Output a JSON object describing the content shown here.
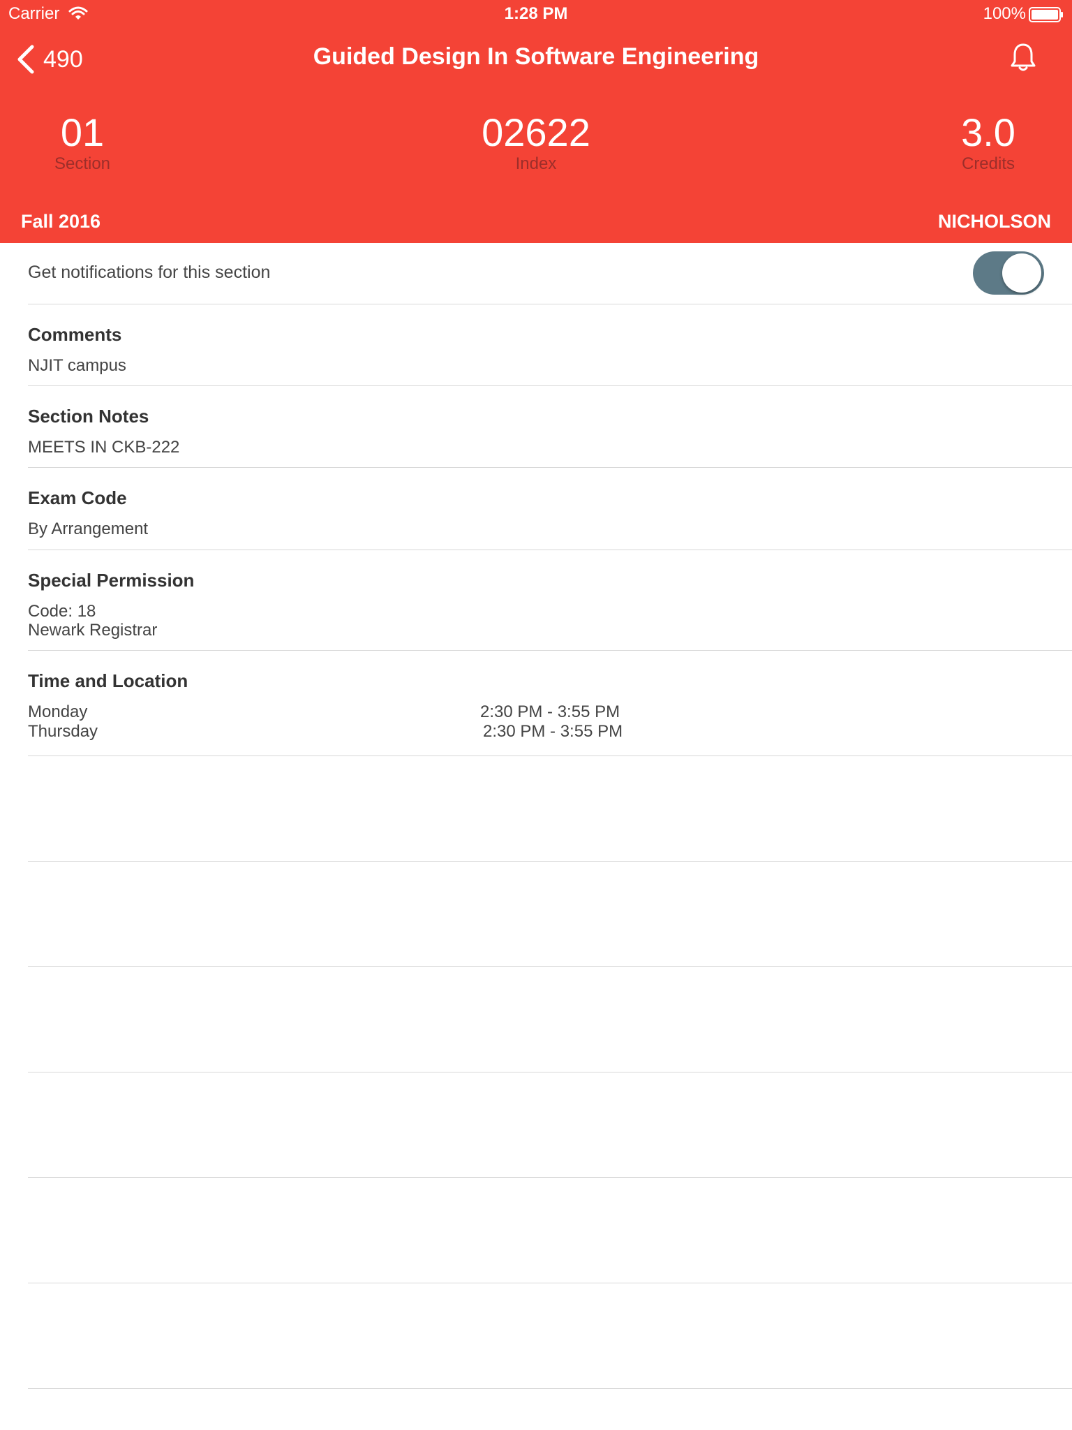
{
  "status_bar": {
    "carrier": "Carrier",
    "time": "1:28 PM",
    "battery": "100%",
    "icons": [
      "wifi-icon",
      "battery-icon"
    ]
  },
  "nav": {
    "back_label": "490",
    "title": "Guided Design In Software Engineering",
    "back_icon": "chevron-left-icon",
    "bell_icon": "bell-icon"
  },
  "stats": {
    "section": {
      "value": "01",
      "label": "Section"
    },
    "index": {
      "value": "02622",
      "label": "Index"
    },
    "credits": {
      "value": "3.0",
      "label": "Credits"
    }
  },
  "term": "Fall 2016",
  "instructor": "NICHOLSON",
  "notifications": {
    "label": "Get notifications for this section",
    "enabled": true
  },
  "comments": {
    "title": "Comments",
    "text": "NJIT campus"
  },
  "section_notes": {
    "title": "Section Notes",
    "text": "MEETS IN CKB-222"
  },
  "exam_code": {
    "title": "Exam Code",
    "text": "By Arrangement"
  },
  "special_permission": {
    "title": "Special Permission",
    "code": "Code: 18",
    "office": "Newark Registrar"
  },
  "time_location": {
    "title": "Time and Location",
    "meetings": [
      {
        "day": "Monday",
        "time": "2:30 PM - 3:55 PM"
      },
      {
        "day": "Thursday",
        "time": "2:30 PM - 3:55 PM"
      }
    ]
  },
  "colors": {
    "header": "#F44336",
    "toggle_on": "#5D7A87",
    "divider": "#d8d8d8"
  }
}
